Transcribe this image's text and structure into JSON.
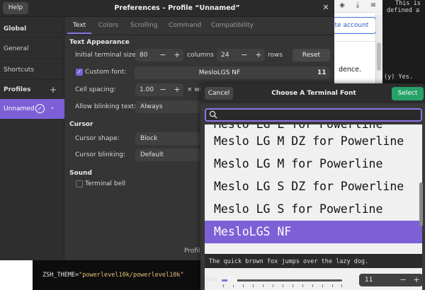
{
  "background_browser": {
    "create_account_label": "ate account",
    "sentence_fragment": "dence.",
    "icons": [
      "shield-icon",
      "download-icon",
      "menu-icon"
    ]
  },
  "background_terminal": {
    "lines": [
      "This is",
      "defined a",
      "(y)  Yes."
    ]
  },
  "code_snippet": {
    "key": "ZSH_THEME=",
    "value": "\"powerlevel10k/powerlevel10k\""
  },
  "window": {
    "help_label": "Help",
    "title": "Preferences – Profile “Unnamed”",
    "close_icon": "close-icon"
  },
  "sidebar": {
    "global_heading": "Global",
    "items": [
      {
        "label": "General"
      },
      {
        "label": "Shortcuts"
      }
    ],
    "profiles_heading": "Profiles",
    "add_profile": "+",
    "profile": {
      "name": "Unnamed"
    }
  },
  "tabs": [
    {
      "label": "Text",
      "active": true
    },
    {
      "label": "Colors",
      "active": false
    },
    {
      "label": "Scrolling",
      "active": false
    },
    {
      "label": "Command",
      "active": false
    },
    {
      "label": "Compatibility",
      "active": false
    }
  ],
  "text_appearance": {
    "heading": "Text Appearance",
    "initial_size_label": "Initial terminal size:",
    "columns_value": "80",
    "columns_label": "columns",
    "rows_value": "24",
    "rows_label": "rows",
    "reset_label": "Reset",
    "custom_font_label": "Custom font:",
    "custom_font_checked": true,
    "font_name": "MesloLGS NF",
    "font_size": "11",
    "cell_spacing_label": "Cell spacing:",
    "cell_spacing_value": "1.00",
    "cell_spacing_suffix": "× wi",
    "blinking_text_label": "Allow blinking text:",
    "blinking_text_value": "Always"
  },
  "cursor": {
    "heading": "Cursor",
    "shape_label": "Cursor shape:",
    "shape_value": "Block",
    "blinking_label": "Cursor blinking:",
    "blinking_value": "Default"
  },
  "sound": {
    "heading": "Sound",
    "bell_label": "Terminal bell",
    "bell_checked": false
  },
  "profile_footer": "Profil",
  "font_dialog": {
    "cancel_label": "Cancel",
    "title": "Choose A Terminal Font",
    "select_label": "Select",
    "search_value": "",
    "fonts": [
      "Meslo LG L for Powerline",
      "Meslo LG M DZ for Powerline",
      "Meslo LG M for Powerline",
      "Meslo LG S DZ for Powerline",
      "Meslo LG S for Powerline",
      "MesloLGS NF"
    ],
    "selected_font": "MesloLGS NF",
    "preview_text": "The quick brown fox jumps over the lazy dog.",
    "size_label": "Size",
    "size_value": "11",
    "size_slider_fraction": 0.09
  },
  "colors": {
    "accent": "#7d60d6",
    "select_button": "#26a269",
    "window_bg": "#353535"
  }
}
